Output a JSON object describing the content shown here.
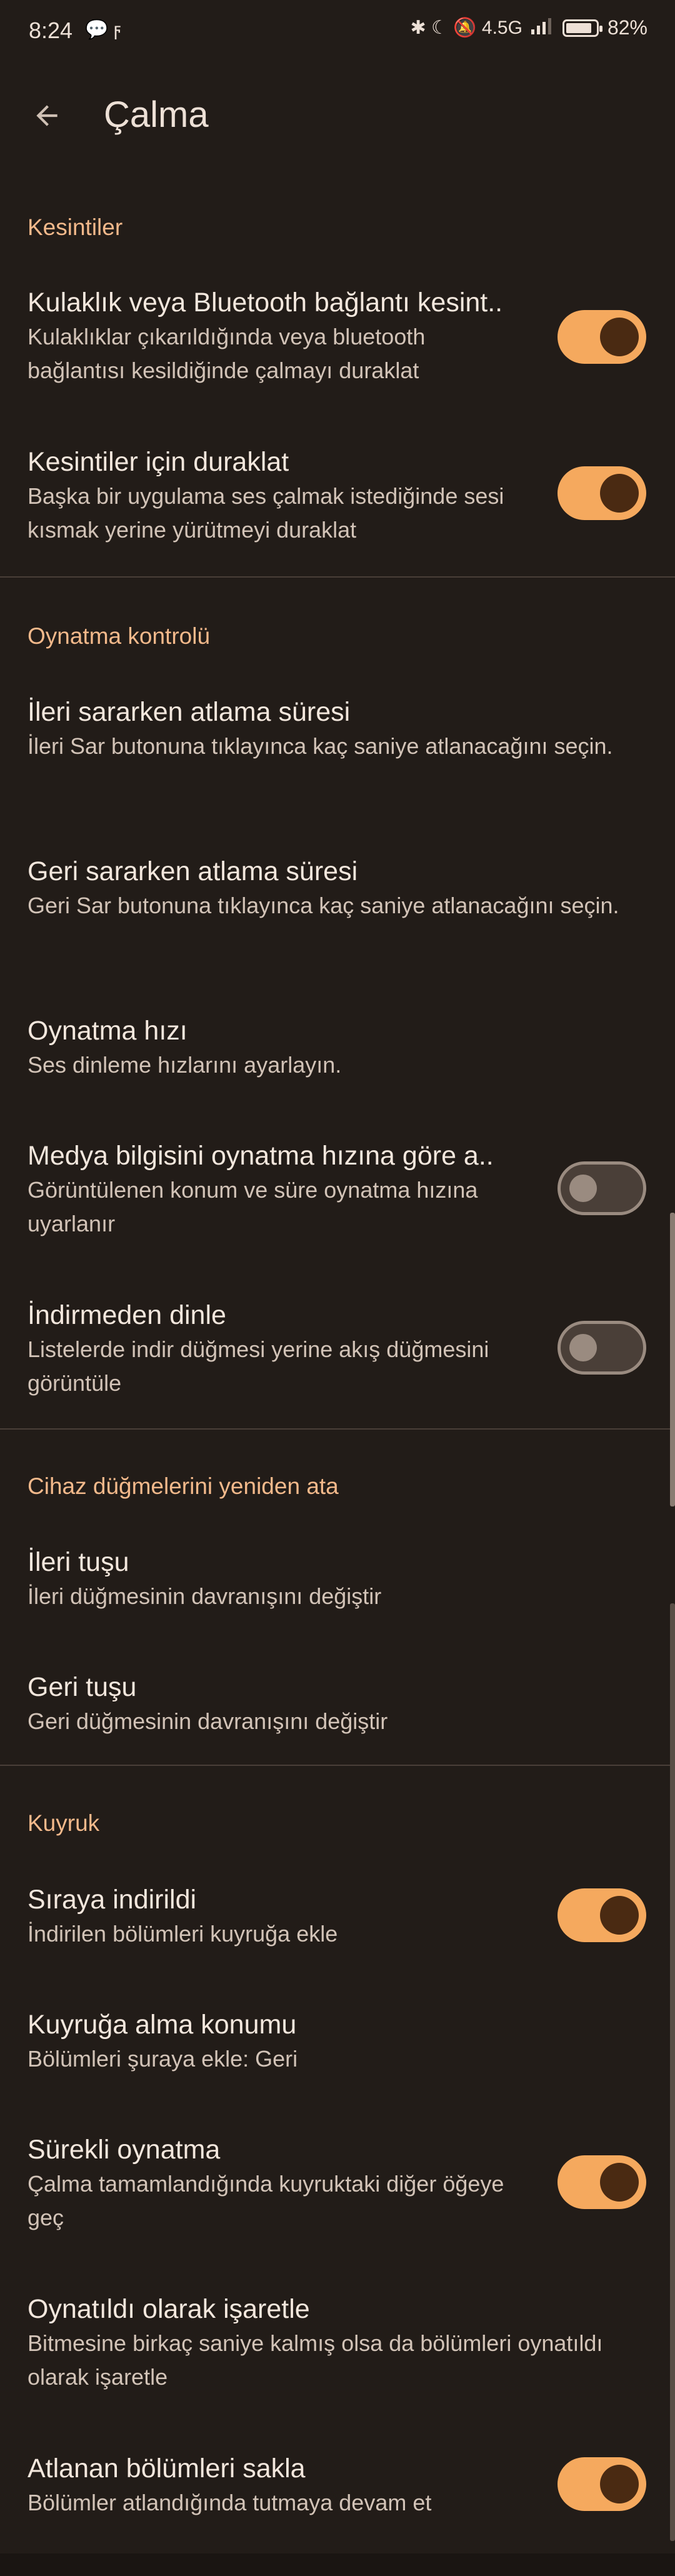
{
  "status_bar": {
    "time": "8:24",
    "left_icons": "💬 ϝ",
    "right_icons": "✱ ☾ 🔕 4.5G",
    "battery_pct": "82%"
  },
  "app_bar": {
    "title": "Çalma",
    "back_icon": "arrow-left-icon"
  },
  "sections": {
    "interruptions": {
      "header": "Kesintiler",
      "headset_title": "Kulaklık veya Bluetooth bağlantı kesint..",
      "headset_sub": "Kulaklıklar çıkarıldığında veya bluetooth bağlantısı kesildiğinde çalmayı duraklat",
      "headset_on": true,
      "pause_title": "Kesintiler için duraklat",
      "pause_sub": "Başka bir uygulama ses çalmak istediğinde sesi kısmak yerine yürütmeyi duraklat",
      "pause_on": true
    },
    "playback": {
      "header": "Oynatma kontrolü",
      "ff_title": "İleri sararken atlama süresi",
      "ff_sub": "İleri Sar butonuna tıklayınca kaç saniye atlanacağını seçin.",
      "rw_title": "Geri sararken atlama süresi",
      "rw_sub": "Geri Sar butonuna tıklayınca kaç saniye atlanacağını seçin.",
      "speed_title": "Oynatma hızı",
      "speed_sub": "Ses dinleme hızlarını ayarlayın.",
      "media_title": "Medya bilgisini oynatma hızına göre a..",
      "media_sub": "Görüntülenen konum ve süre oynatma hızına uyarlanır",
      "media_on": false,
      "stream_title": "İndirmeden dinle",
      "stream_sub": "Listelerde indir düğmesi yerine akış düğmesini görüntüle",
      "stream_on": false
    },
    "remap": {
      "header": "Cihaz düğmelerini yeniden ata",
      "fwd_title": "İleri tuşu",
      "fwd_sub": "İleri düğmesinin davranışını değiştir",
      "back_title": "Geri tuşu",
      "back_sub": "Geri düğmesinin davranışını değiştir"
    },
    "queue": {
      "header": "Kuyruk",
      "enq_title": "Sıraya indirildi",
      "enq_sub": "İndirilen bölümleri kuyruğa ekle",
      "enq_on": true,
      "loc_title": "Kuyruğa alma konumu",
      "loc_sub": "Bölümleri şuraya ekle: Geri",
      "cont_title": "Sürekli oynatma",
      "cont_sub": "Çalma tamamlandığında kuyruktaki diğer öğeye geç",
      "cont_on": true,
      "mark_title": "Oynatıldı olarak işaretle",
      "mark_sub": "Bitmesine birkaç saniye kalmış olsa da bölümleri oynatıldı olarak işaretle",
      "skip_title": "Atlanan bölümleri sakla",
      "skip_sub": "Bölümler atlandığında tutmaya devam et",
      "skip_on": true
    }
  },
  "colors": {
    "background": "#221c18",
    "accent": "#f3b98b",
    "switch_on": "#f5a95e"
  }
}
